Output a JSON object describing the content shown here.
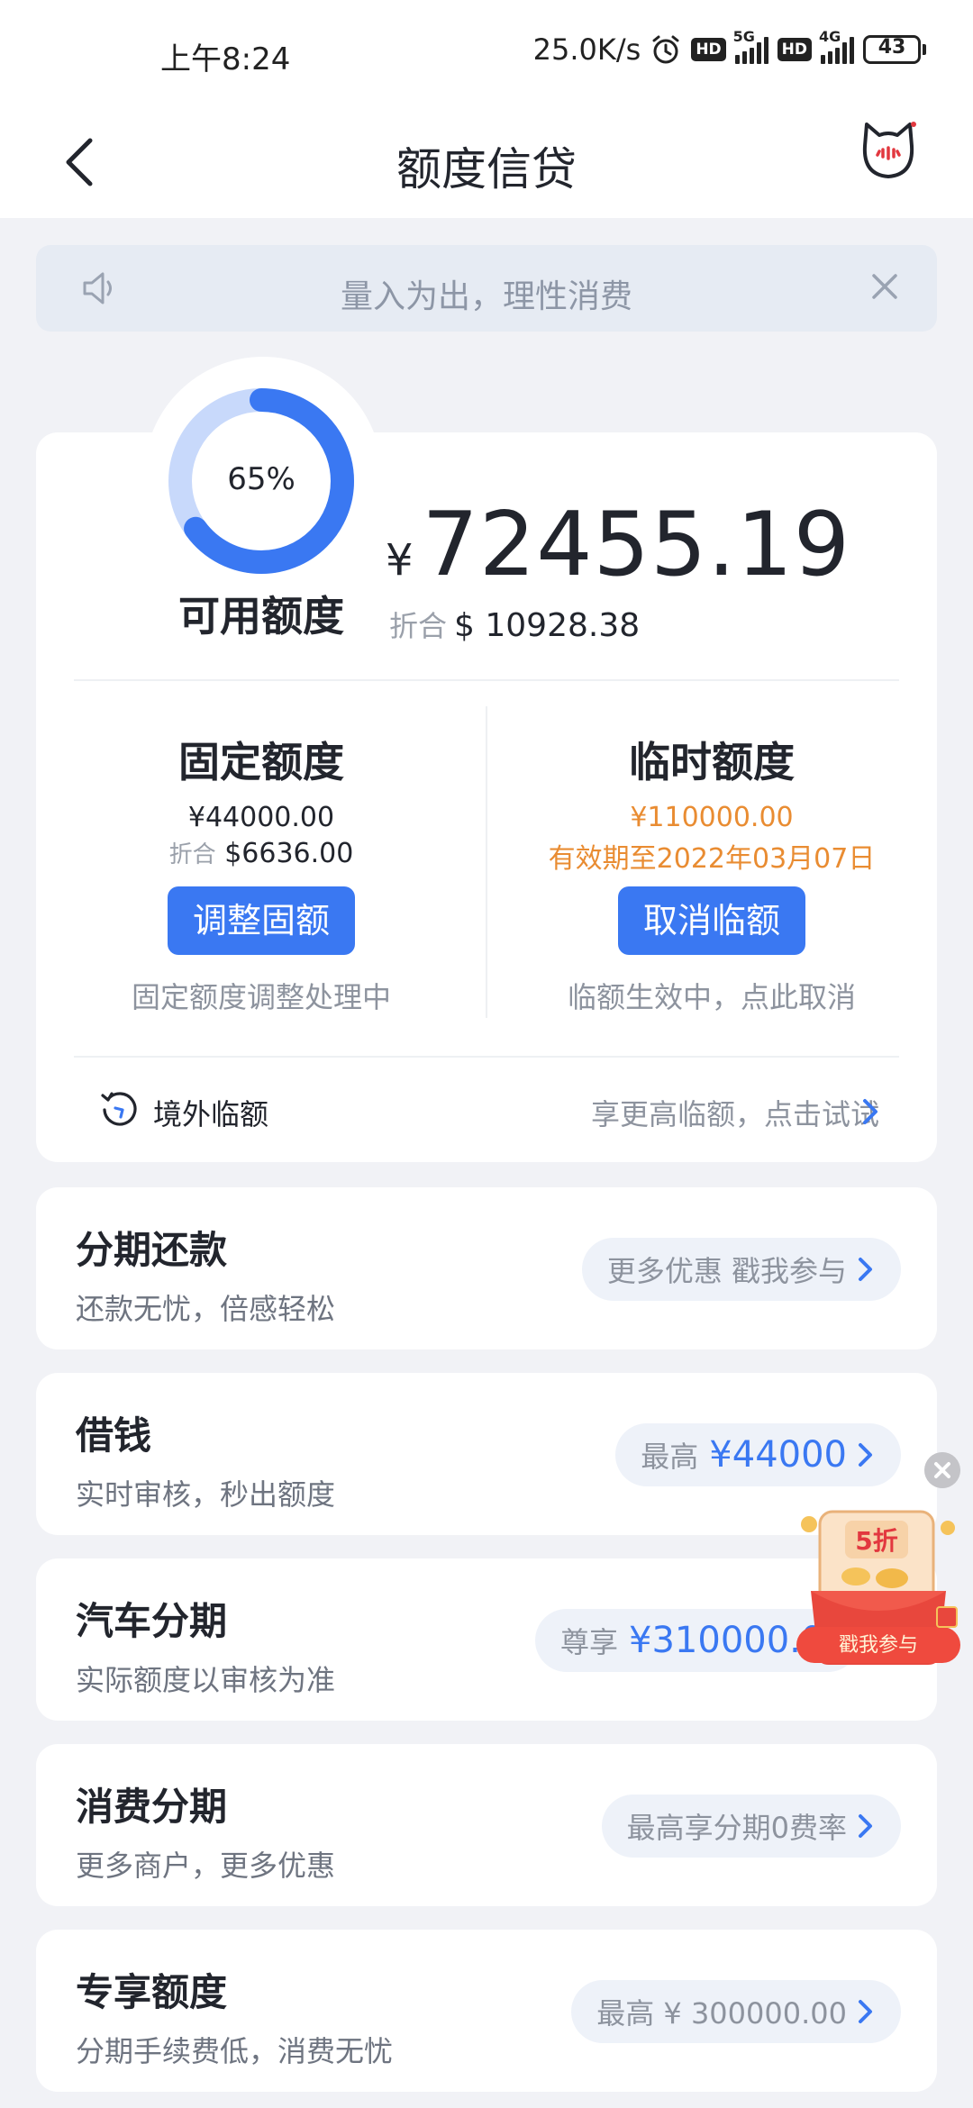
{
  "status_bar": {
    "time": "上午8:24",
    "speed": "25.0K/s",
    "net1": "5G",
    "net2": "4G",
    "hd": "HD",
    "battery": "43"
  },
  "header": {
    "title": "额度信贷"
  },
  "notice": {
    "text": "量入为出，理性消费"
  },
  "credit": {
    "percent_label": "65%",
    "percent_value": 0.65,
    "available_label": "可用额度",
    "currency_symbol": "¥",
    "amount": "72455.19",
    "usd_label": "折合",
    "usd_amount": "$ 10928.38"
  },
  "fixed": {
    "title": "固定额度",
    "amount": "¥44000.00",
    "usd_label": "折合",
    "usd_amount": "$6636.00",
    "button": "调整固额",
    "hint": "固定额度调整处理中"
  },
  "temp": {
    "title": "临时额度",
    "amount": "¥110000.00",
    "validity": "有效期至2022年03月07日",
    "button": "取消临额",
    "hint": "临额生效中，点此取消"
  },
  "overseas": {
    "label": "境外临额",
    "action": "享更高临额，点击试试"
  },
  "features": [
    {
      "title": "分期还款",
      "subtitle": "还款无忧，倍感轻松",
      "pill_text": "更多优惠 戳我参与",
      "pill_value": ""
    },
    {
      "title": "借钱",
      "subtitle": "实时审核，秒出额度",
      "pill_text": "最高",
      "pill_value": "¥44000"
    },
    {
      "title": "汽车分期",
      "subtitle": "实际额度以审核为准",
      "pill_text": "尊享",
      "pill_value": "¥310000.0"
    },
    {
      "title": "消费分期",
      "subtitle": "更多商户，更多优惠",
      "pill_text": "最高享分期0费率",
      "pill_value": ""
    },
    {
      "title": "专享额度",
      "subtitle": "分期手续费低，消费无忧",
      "pill_text": "最高 ¥ 300000.00",
      "pill_value": ""
    }
  ],
  "promo": {
    "discount": "5折",
    "cta": "戳我参与"
  },
  "colors": {
    "accent": "#3a78f2",
    "orange": "#e98c32",
    "background": "#f1f2f6"
  }
}
